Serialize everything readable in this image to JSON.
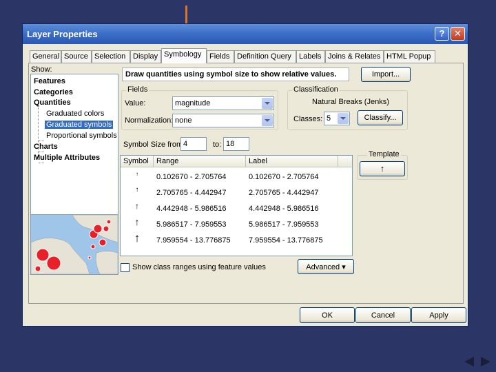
{
  "window": {
    "title": "Layer Properties",
    "help": "?",
    "close": "✕"
  },
  "tabs": [
    "General",
    "Source",
    "Selection",
    "Display",
    "Symbology",
    "Fields",
    "Definition Query",
    "Labels",
    "Joins & Relates",
    "HTML Popup"
  ],
  "show_label": "Show:",
  "tree": {
    "features": "Features",
    "categories": "Categories",
    "quantities": "Quantities",
    "graduated_colors": "Graduated colors",
    "graduated_symbols": "Graduated symbols",
    "proportional_symbols": "Proportional symbols",
    "charts": "Charts",
    "multiple_attributes": "Multiple Attributes"
  },
  "description": "Draw quantities using symbol size to show relative values.",
  "import_label": "Import...",
  "fields": {
    "title": "Fields",
    "value_label": "Value:",
    "value": "magnitude",
    "normalization_label": "Normalization:",
    "normalization": "none"
  },
  "classification": {
    "title": "Classification",
    "method": "Natural Breaks (Jenks)",
    "classes_label": "Classes:",
    "classes": "5",
    "classify_label": "Classify..."
  },
  "symbol_size": {
    "from_label": "Symbol Size from:",
    "from": "4",
    "to_label": "to:",
    "to": "18"
  },
  "table": {
    "headers": [
      "Symbol",
      "Range",
      "Label"
    ],
    "rows": [
      {
        "range": "0.102670 - 2.705764",
        "label": "0.102670 - 2.705764",
        "size": 8
      },
      {
        "range": "2.705765 - 4.442947",
        "label": "2.705765 - 4.442947",
        "size": 10
      },
      {
        "range": "4.442948 - 5.986516",
        "label": "4.442948 - 5.986516",
        "size": 12
      },
      {
        "range": "5.986517 - 7.959553",
        "label": "5.986517 - 7.959553",
        "size": 14
      },
      {
        "range": "7.959554 - 13.776875",
        "label": "7.959554 - 13.776875",
        "size": 17
      }
    ]
  },
  "templates": {
    "title": "Template",
    "symbol": "↑"
  },
  "show_class_ranges": "Show class ranges using feature values",
  "advanced_label": "Advanced ▾",
  "buttons": {
    "ok": "OK",
    "cancel": "Cancel",
    "apply": "Apply"
  },
  "colors": {
    "arrow": "#e0742c",
    "background": "#2b3566",
    "selected": "#316ac5",
    "map_water": "#9fc6e8",
    "map_land": "#e6e2d6",
    "map_points": "#e8202a"
  }
}
